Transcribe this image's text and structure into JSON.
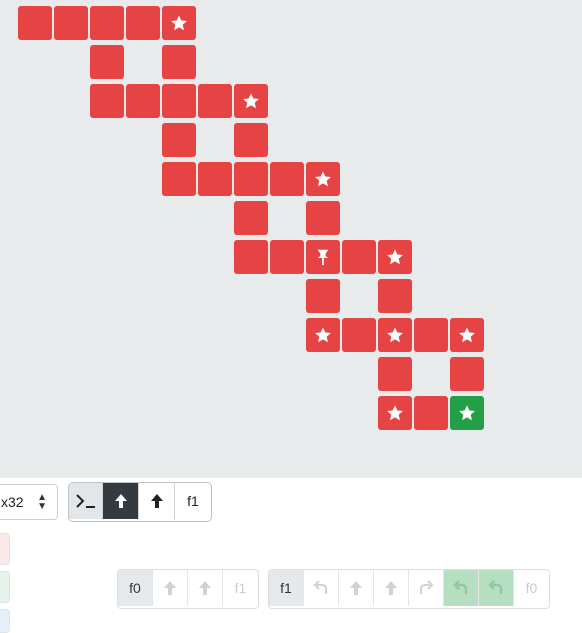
{
  "board": {
    "tiles": [
      {
        "c": 0,
        "r": 0,
        "type": "plain"
      },
      {
        "c": 1,
        "r": 0,
        "type": "plain"
      },
      {
        "c": 2,
        "r": 0,
        "type": "plain"
      },
      {
        "c": 3,
        "r": 0,
        "type": "plain"
      },
      {
        "c": 4,
        "r": 0,
        "type": "star"
      },
      {
        "c": 2,
        "r": 1,
        "type": "plain"
      },
      {
        "c": 4,
        "r": 1,
        "type": "plain"
      },
      {
        "c": 2,
        "r": 2,
        "type": "plain"
      },
      {
        "c": 3,
        "r": 2,
        "type": "plain"
      },
      {
        "c": 4,
        "r": 2,
        "type": "plain"
      },
      {
        "c": 5,
        "r": 2,
        "type": "plain"
      },
      {
        "c": 6,
        "r": 2,
        "type": "star"
      },
      {
        "c": 4,
        "r": 3,
        "type": "plain"
      },
      {
        "c": 6,
        "r": 3,
        "type": "plain"
      },
      {
        "c": 4,
        "r": 4,
        "type": "plain"
      },
      {
        "c": 5,
        "r": 4,
        "type": "plain"
      },
      {
        "c": 6,
        "r": 4,
        "type": "plain"
      },
      {
        "c": 7,
        "r": 4,
        "type": "plain"
      },
      {
        "c": 8,
        "r": 4,
        "type": "star"
      },
      {
        "c": 6,
        "r": 5,
        "type": "plain"
      },
      {
        "c": 8,
        "r": 5,
        "type": "plain"
      },
      {
        "c": 6,
        "r": 6,
        "type": "plain"
      },
      {
        "c": 7,
        "r": 6,
        "type": "plain"
      },
      {
        "c": 8,
        "r": 6,
        "type": "pin"
      },
      {
        "c": 9,
        "r": 6,
        "type": "plain"
      },
      {
        "c": 10,
        "r": 6,
        "type": "star"
      },
      {
        "c": 8,
        "r": 7,
        "type": "plain"
      },
      {
        "c": 10,
        "r": 7,
        "type": "plain"
      },
      {
        "c": 8,
        "r": 8,
        "type": "star"
      },
      {
        "c": 9,
        "r": 8,
        "type": "plain"
      },
      {
        "c": 10,
        "r": 8,
        "type": "star"
      },
      {
        "c": 11,
        "r": 8,
        "type": "plain"
      },
      {
        "c": 12,
        "r": 8,
        "type": "star"
      },
      {
        "c": 10,
        "r": 9,
        "type": "plain"
      },
      {
        "c": 12,
        "r": 9,
        "type": "plain"
      },
      {
        "c": 10,
        "r": 10,
        "type": "star"
      },
      {
        "c": 11,
        "r": 10,
        "type": "plain"
      },
      {
        "c": 12,
        "r": 10,
        "type": "star",
        "goal": true
      }
    ],
    "colors": {
      "tile": "#e64444",
      "goal": "#23a047",
      "background": "#e8ebec"
    }
  },
  "controls": {
    "speed_value": "x32",
    "run_icon": "terminal-prompt-icon",
    "step_label_icon": "arrow-up-icon",
    "forward_icon": "arrow-up-icon",
    "f1_label": "f1"
  },
  "program": {
    "f0": {
      "label": "f0",
      "slots": [
        "arrow-up-icon",
        "arrow-up-icon",
        "f1"
      ]
    },
    "f1": {
      "label": "f1",
      "slots": [
        "turn-left-icon",
        "arrow-up-icon",
        "arrow-up-icon",
        "turn-right-icon",
        "green-left",
        "green-left",
        "f0"
      ]
    }
  }
}
